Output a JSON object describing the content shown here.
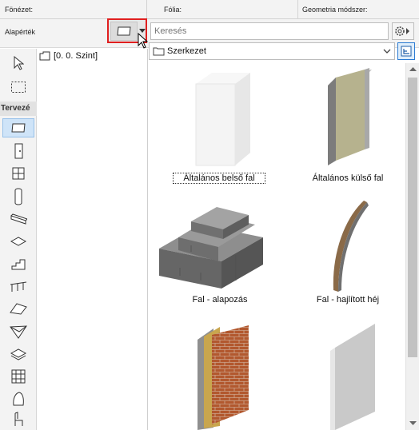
{
  "header": {
    "fonezet_label": "Fönézet:",
    "folia_label": "Fólia:",
    "geometria_label": "Geometria módszer:",
    "alapertek_label": "Alapérték"
  },
  "search": {
    "placeholder": "Keresés"
  },
  "folder_select": {
    "value": "Szerkezet"
  },
  "toolbox": {
    "section_label": "Tervezé",
    "tools": [
      "arrow",
      "marquee",
      "wall",
      "door",
      "window",
      "column",
      "beam",
      "slab",
      "stair",
      "railing",
      "roof",
      "shell",
      "mesh",
      "curtain-wall",
      "morph",
      "object"
    ]
  },
  "tree": {
    "items": [
      {
        "label": "[0. 0. Szint]"
      }
    ]
  },
  "library": {
    "items": [
      {
        "label": "Általános belső fal"
      },
      {
        "label": "Általános külső fal"
      },
      {
        "label": "Fal - alapozás"
      },
      {
        "label": "Fal - hajlított héj"
      },
      {
        "label": ""
      },
      {
        "label": ""
      }
    ]
  },
  "colors": {
    "accent": "#2b7bd3",
    "highlight": "#e01f1f",
    "selected": "#cfe4f8"
  }
}
